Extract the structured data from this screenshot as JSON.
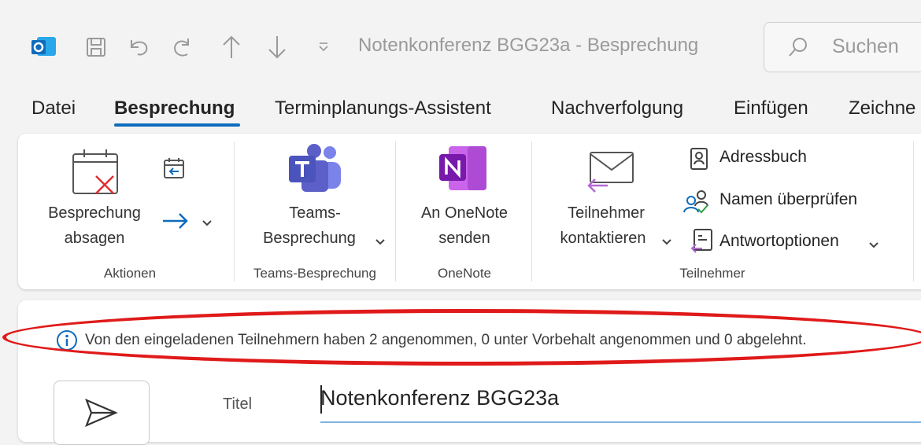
{
  "window": {
    "title": "Notenkonferenz BGG23a  -  Besprechung",
    "search_placeholder": "Suchen"
  },
  "quick_access": [
    "outlook-logo-icon",
    "save-icon",
    "undo-icon",
    "redo-icon",
    "up-icon",
    "down-icon",
    "customize-icon"
  ],
  "tabs": [
    {
      "label": "Datei"
    },
    {
      "label": "Besprechung"
    },
    {
      "label": "Terminplanungs-Assistent"
    },
    {
      "label": "Nachverfolgung"
    },
    {
      "label": "Einfügen"
    },
    {
      "label": "Zeichne"
    }
  ],
  "ribbon": {
    "aktionen": {
      "cancel_label_1": "Besprechung",
      "cancel_label_2": "absagen",
      "group": "Aktionen"
    },
    "teams": {
      "label_1": "Teams-",
      "label_2": "Besprechung",
      "group": "Teams-Besprechung"
    },
    "onenote": {
      "label_1": "An OneNote",
      "label_2": "senden",
      "group": "OneNote"
    },
    "teilnehmer": {
      "contact_label_1": "Teilnehmer",
      "contact_label_2": "kontaktieren",
      "address_book": "Adressbuch",
      "check_names": "Namen überprüfen",
      "response_options": "Antwortoptionen",
      "group": "Teilnehmer"
    }
  },
  "info_bar": {
    "text": "Von den eingeladenen Teilnehmern haben 2 angenommen, 0 unter Vorbehalt angenommen und 0 abgelehnt."
  },
  "form": {
    "title_label": "Titel",
    "title_value": "Notenkonferenz BGG23a"
  },
  "colors": {
    "accent": "#0f6cbd",
    "highlight_ellipse": "#e01a1a",
    "teams": "#5b5fc7",
    "onenote": "#7719aa"
  }
}
